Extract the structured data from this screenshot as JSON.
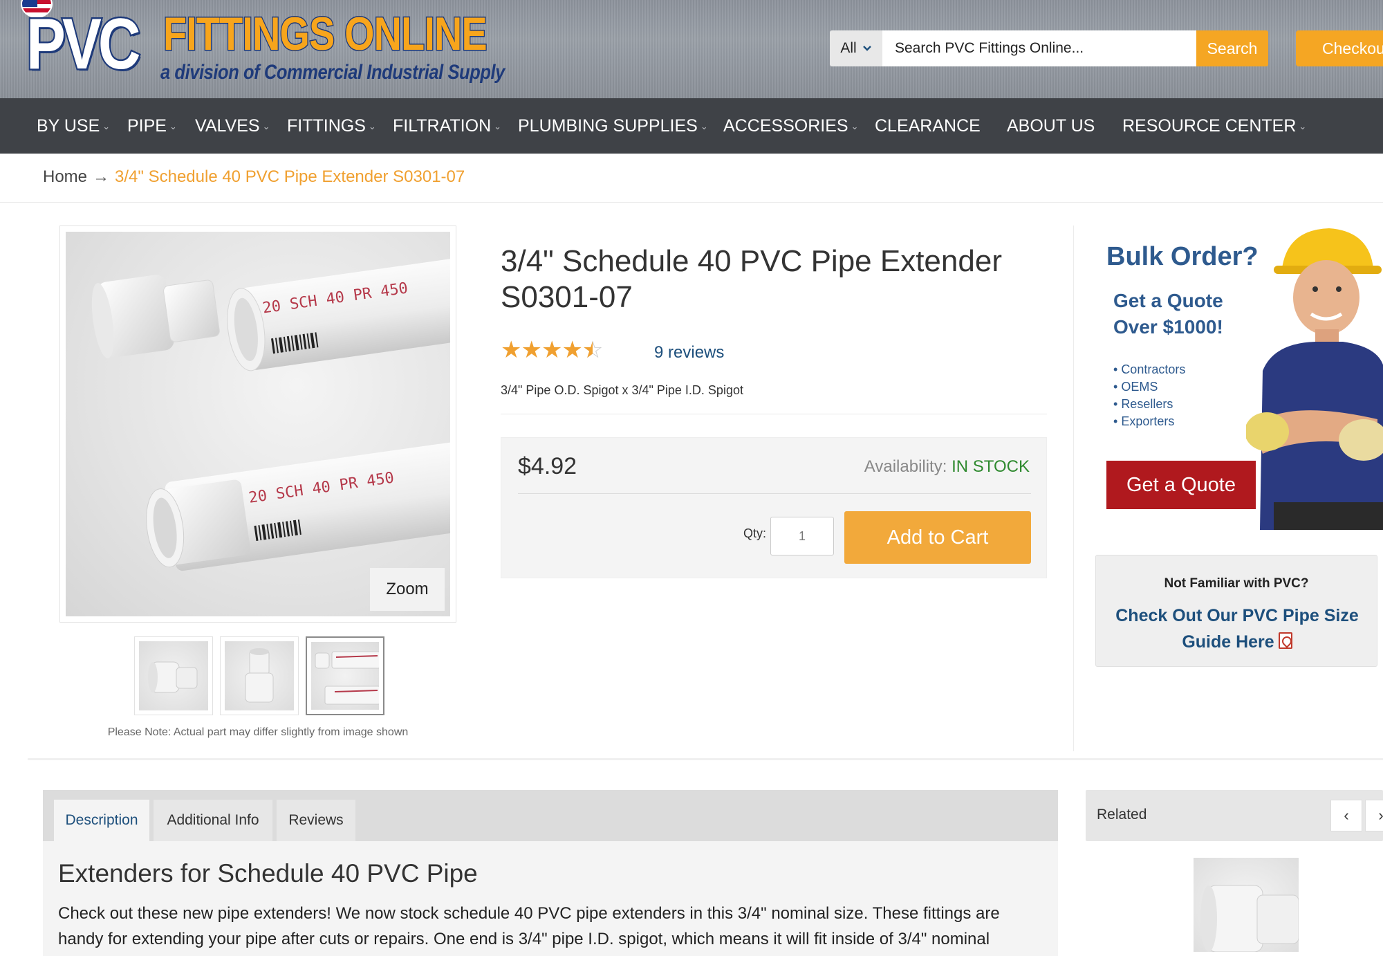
{
  "header": {
    "logo_main": "PVC",
    "logo_secondary": "FITTINGS ONLINE",
    "logo_tagline": "a division of Commercial Industrial Supply",
    "search_category": "All",
    "search_placeholder": "Search PVC Fittings Online...",
    "search_button": "Search",
    "checkout_button": "Checkou"
  },
  "nav": {
    "items": [
      {
        "label": "BY USE",
        "dropdown": true
      },
      {
        "label": "PIPE",
        "dropdown": true
      },
      {
        "label": "VALVES",
        "dropdown": true
      },
      {
        "label": "FITTINGS",
        "dropdown": true
      },
      {
        "label": "FILTRATION",
        "dropdown": true
      },
      {
        "label": "PLUMBING SUPPLIES",
        "dropdown": true
      },
      {
        "label": "ACCESSORIES",
        "dropdown": true
      },
      {
        "label": "CLEARANCE",
        "dropdown": false
      },
      {
        "label": "ABOUT US",
        "dropdown": false
      },
      {
        "label": "RESOURCE CENTER",
        "dropdown": true
      }
    ]
  },
  "breadcrumb": {
    "home": "Home",
    "arrow": "→",
    "current": "3/4\" Schedule 40 PVC Pipe Extender S0301-07"
  },
  "gallery": {
    "zoom_label": "Zoom",
    "note": "Please Note: Actual part may differ slightly from image shown",
    "pipe_print_top": "20 SCH 40 PR 450",
    "pipe_print_bottom": "20 SCH 40 PR 450",
    "thumb_count": 3,
    "active_thumb": 3
  },
  "product": {
    "title": "3/4\" Schedule 40 PVC Pipe Extender S0301-07",
    "rating": 4.5,
    "rating_max": 5,
    "reviews": "9 reviews",
    "subtitle": "3/4\" Pipe O.D. Spigot x 3/4\" Pipe I.D. Spigot",
    "price": "$4.92",
    "availability_label": "Availability:",
    "availability_value": "IN STOCK",
    "qty_label": "Qty:",
    "qty_value": "1",
    "add_to_cart": "Add to Cart"
  },
  "sidebar": {
    "bulk_title": "Bulk Order?",
    "bulk_sub_1": "Get a Quote",
    "bulk_sub_2": "Over $1000!",
    "bulk_list": [
      "Contractors",
      "OEMS",
      "Resellers",
      "Exporters"
    ],
    "quote_button": "Get a Quote",
    "pvc_question": "Not Familiar with PVC?",
    "pvc_link": "Check Out Our PVC Pipe Size Guide Here"
  },
  "tabs": {
    "items": [
      "Description",
      "Additional Info",
      "Reviews"
    ],
    "active": "Description"
  },
  "description": {
    "heading": "Extenders for Schedule 40 PVC Pipe",
    "body": "Check out these new pipe extenders! We now stock schedule 40 PVC pipe extenders in this 3/4\" nominal size. These fittings are handy for extending your pipe after cuts or repairs. One end is 3/4\" pipe I.D. spigot, which means it will fit inside of 3/4\" nominal"
  },
  "related": {
    "label": "Related",
    "prev": "‹",
    "next": "›"
  },
  "colors": {
    "accent_orange": "#f5a623",
    "nav_bg": "#3f4247",
    "link_blue": "#1d4f7c",
    "stock_green": "#2f8a2f",
    "quote_red": "#b0191e"
  }
}
